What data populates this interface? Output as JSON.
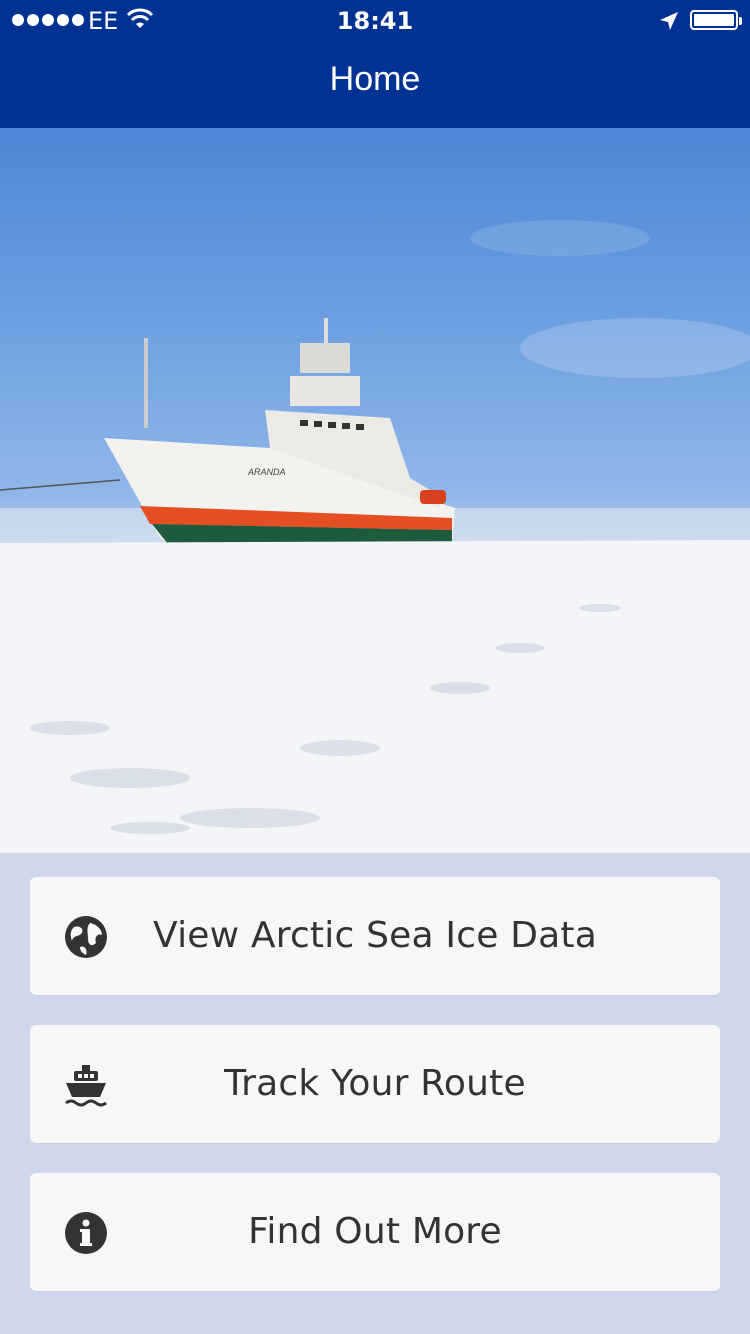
{
  "status_bar": {
    "carrier": "EE",
    "time": "18:41",
    "signal_bars": 5,
    "battery_level": 1.0
  },
  "nav": {
    "title": "Home"
  },
  "hero": {
    "ship_name": "ARANDA"
  },
  "buttons": [
    {
      "label": "View Arctic Sea Ice Data",
      "icon": "globe-icon"
    },
    {
      "label": "Track Your Route",
      "icon": "ship-icon"
    },
    {
      "label": "Find Out More",
      "icon": "info-icon"
    }
  ],
  "colors": {
    "nav_background": "#003294",
    "page_background": "#cfd8ea",
    "button_background": "#f7f7f7",
    "button_text": "#333333"
  }
}
